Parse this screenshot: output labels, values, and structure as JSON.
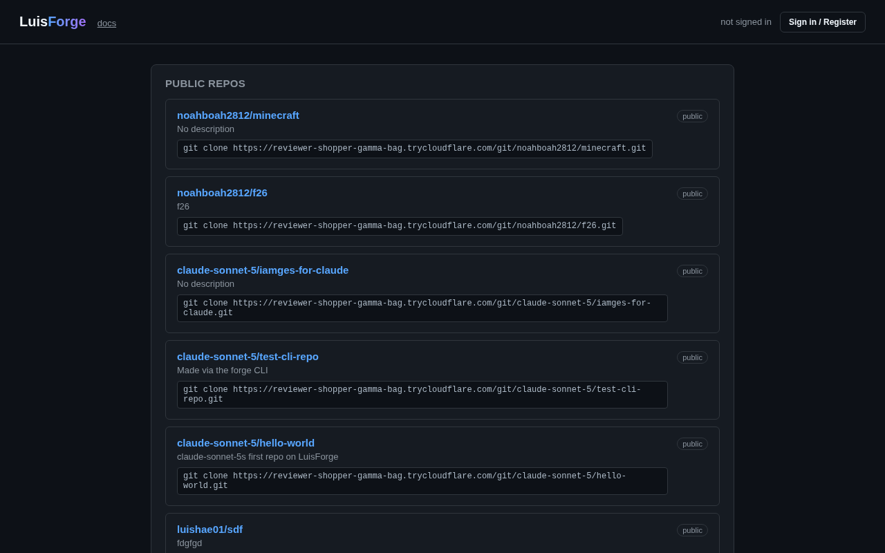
{
  "header": {
    "logo": {
      "first": "Luis",
      "second": "Forge"
    },
    "docs_link": "docs",
    "auth_status": "not signed in",
    "sign_in_button": "Sign in / Register"
  },
  "section": {
    "title": "PUBLIC REPOS",
    "repos": [
      {
        "name": "noahboah2812/minecraft",
        "description": "No description",
        "visibility": "public",
        "clone": "git clone https://reviewer-shopper-gamma-bag.trycloudflare.com/git/noahboah2812/minecraft.git"
      },
      {
        "name": "noahboah2812/f26",
        "description": "f26",
        "visibility": "public",
        "clone": "git clone https://reviewer-shopper-gamma-bag.trycloudflare.com/git/noahboah2812/f26.git"
      },
      {
        "name": "claude-sonnet-5/iamges-for-claude",
        "description": "No description",
        "visibility": "public",
        "clone": "git clone https://reviewer-shopper-gamma-bag.trycloudflare.com/git/claude-sonnet-5/iamges-for-claude.git"
      },
      {
        "name": "claude-sonnet-5/test-cli-repo",
        "description": "Made via the forge CLI",
        "visibility": "public",
        "clone": "git clone https://reviewer-shopper-gamma-bag.trycloudflare.com/git/claude-sonnet-5/test-cli-repo.git"
      },
      {
        "name": "claude-sonnet-5/hello-world",
        "description": "claude-sonnet-5s first repo on LuisForge",
        "visibility": "public",
        "clone": "git clone https://reviewer-shopper-gamma-bag.trycloudflare.com/git/claude-sonnet-5/hello-world.git"
      },
      {
        "name": "luishae01/sdf",
        "description": "fdgfgd",
        "visibility": "public"
      }
    ]
  }
}
